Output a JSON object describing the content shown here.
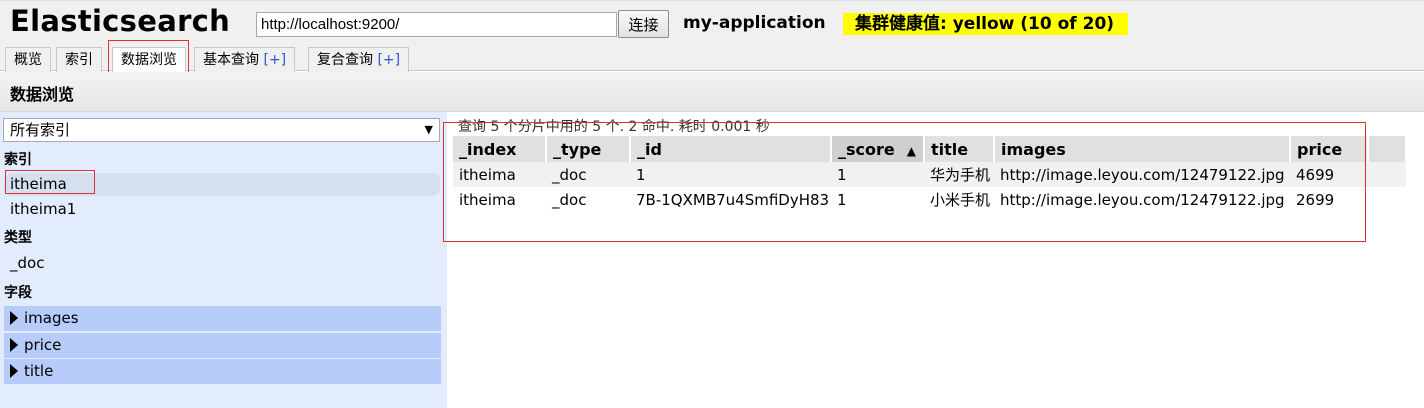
{
  "header": {
    "title": "Elasticsearch",
    "url": "http://localhost:9200/",
    "connect_label": "连接",
    "cluster_name": "my-application",
    "cluster_health": "集群健康值: yellow (10 of 20)",
    "health_color": "#ffff00"
  },
  "tabs": [
    {
      "label": "概览"
    },
    {
      "label": "索引"
    },
    {
      "label": "数据浏览",
      "active": true
    },
    {
      "label": "基本查询",
      "plus": "[+]"
    },
    {
      "label": "复合查询",
      "plus": "[+]"
    }
  ],
  "section": {
    "title": "数据浏览"
  },
  "sidebar": {
    "index_select": "所有索引",
    "indices_heading": "索引",
    "indices": [
      "itheima",
      "itheima1"
    ],
    "types_heading": "类型",
    "types": [
      "_doc"
    ],
    "fields_heading": "字段",
    "fields": [
      "images",
      "price",
      "title"
    ]
  },
  "results": {
    "summary": "查询 5 个分片中用的 5 个. 2 命中. 耗时 0.001 秒",
    "columns": [
      "_index",
      "_type",
      "_id",
      "_score",
      "title",
      "images",
      "price"
    ],
    "sorted_column": "_score",
    "sort_arrow": "▲",
    "rows": [
      [
        "itheima",
        "_doc",
        "1",
        "1",
        "华为手机",
        "http://image.leyou.com/12479122.jpg",
        "4699"
      ],
      [
        "itheima",
        "_doc",
        "7B-1QXMB7u4SmfiDyH83",
        "1",
        "小米手机",
        "http://image.leyou.com/12479122.jpg",
        "2699"
      ]
    ]
  }
}
